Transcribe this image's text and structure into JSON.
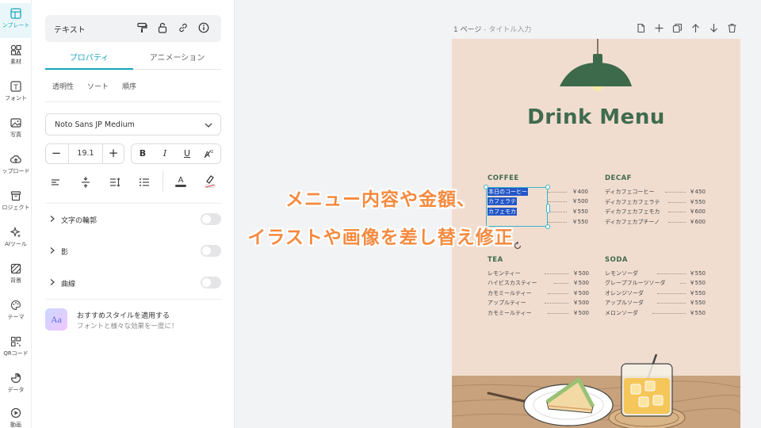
{
  "rail": [
    {
      "label": "ンプレート",
      "icon": "template-icon",
      "active": true
    },
    {
      "label": "素材",
      "icon": "elements-icon"
    },
    {
      "label": "フォント",
      "icon": "text-icon"
    },
    {
      "label": "写真",
      "icon": "photo-icon"
    },
    {
      "label": "ップロード",
      "icon": "upload-icon"
    },
    {
      "label": "ロジェクト",
      "icon": "folder-icon"
    },
    {
      "label": "AIツール",
      "icon": "ai-sparkle-icon"
    },
    {
      "label": "背景",
      "icon": "background-icon"
    },
    {
      "label": "テーマ",
      "icon": "palette-icon"
    },
    {
      "label": "QRコード",
      "icon": "qr-code-icon"
    },
    {
      "label": "データ",
      "icon": "chart-icon"
    },
    {
      "label": "動画",
      "icon": "video-icon"
    }
  ],
  "panel": {
    "element_type": "テキスト",
    "tabs": [
      "プロパティ",
      "アニメーション"
    ],
    "subtabs": [
      "透明性",
      "ソート",
      "順序"
    ],
    "font": "Noto Sans JP Medium",
    "font_size": "19.1",
    "style_buttons": [
      "B",
      "I",
      "U"
    ],
    "toggles": [
      {
        "label": "文字の輪郭"
      },
      {
        "label": "影"
      },
      {
        "label": "曲線"
      }
    ],
    "suggest_title": "おすすめスタイルを適用する",
    "suggest_sub": "フォントと様々な効果を一度に！",
    "suggest_badge": "Aa"
  },
  "canvas": {
    "page_label": "1 ページ",
    "page_title_placeholder": " - タイトル入力"
  },
  "poster": {
    "title": "Drink Menu",
    "sections": [
      {
        "title": "COFFEE",
        "items": [
          {
            "name": "本日のコーヒー",
            "price": "￥400"
          },
          {
            "name": "カフェラテ",
            "price": "￥500"
          },
          {
            "name": "カフェモカ",
            "price": "￥550"
          },
          {
            "name": "",
            "price": "￥550"
          }
        ]
      },
      {
        "title": "DECAF",
        "items": [
          {
            "name": "ディカフェコーヒー",
            "price": "￥450"
          },
          {
            "name": "ディカフェカフェラテ",
            "price": "￥550"
          },
          {
            "name": "ディカフェカフェモカ",
            "price": "￥600"
          },
          {
            "name": "ディカフェカプチーノ",
            "price": "￥600"
          }
        ]
      },
      {
        "title": "TEA",
        "items": [
          {
            "name": "レモンティー",
            "price": "￥500"
          },
          {
            "name": "ハイビスカスティー",
            "price": "￥500"
          },
          {
            "name": "カモミールティー",
            "price": "￥500"
          },
          {
            "name": "アップルティー",
            "price": "￥500"
          },
          {
            "name": "カモミールティー",
            "price": "￥500"
          }
        ]
      },
      {
        "title": "SODA",
        "items": [
          {
            "name": "レモンソーダ",
            "price": "￥550"
          },
          {
            "name": "グレープフルーツソーダ",
            "price": "￥550"
          },
          {
            "name": "オレンジソーダ",
            "price": "￥550"
          },
          {
            "name": "アップルソーダ",
            "price": "￥550"
          },
          {
            "name": "メロンソーダ",
            "price": "￥550"
          }
        ]
      }
    ]
  },
  "caption": {
    "line1": "メニュー内容や金額、",
    "line2": "イラストや画像を差し替え修正"
  },
  "colors": {
    "accent": "#1aa4bd",
    "poster_bg": "#f1ddd0",
    "menu_green": "#3f6b4f",
    "caption_orange": "#f58a3f"
  }
}
